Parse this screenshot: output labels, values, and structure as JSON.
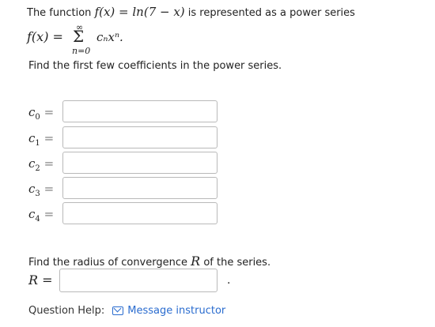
{
  "problem": {
    "intro_prefix": "The function ",
    "intro_function": "f(x) = ln(7 − x)",
    "intro_suffix": " is represented as a power series",
    "series_lhs": "f(x) =",
    "sum_upper": "∞",
    "sum_symbol": "Σ",
    "sum_lower": "n=0",
    "series_term": "cₙxⁿ.",
    "prompt_coefficients": "Find the first few coefficients in the power series."
  },
  "coefficients": [
    {
      "label": "c",
      "sub": "0",
      "value": ""
    },
    {
      "label": "c",
      "sub": "1",
      "value": ""
    },
    {
      "label": "c",
      "sub": "2",
      "value": ""
    },
    {
      "label": "c",
      "sub": "3",
      "value": ""
    },
    {
      "label": "c",
      "sub": "4",
      "value": ""
    }
  ],
  "radius": {
    "prompt_prefix": "Find the radius of convergence ",
    "prompt_symbol": "R",
    "prompt_suffix": " of the series.",
    "label": "R =",
    "value": "",
    "trailing": "."
  },
  "help": {
    "label": "Question Help:",
    "icon": "mail-icon",
    "link": "Message instructor"
  },
  "colors": {
    "link": "#2a6ccf",
    "border": "#b9b9b9"
  }
}
